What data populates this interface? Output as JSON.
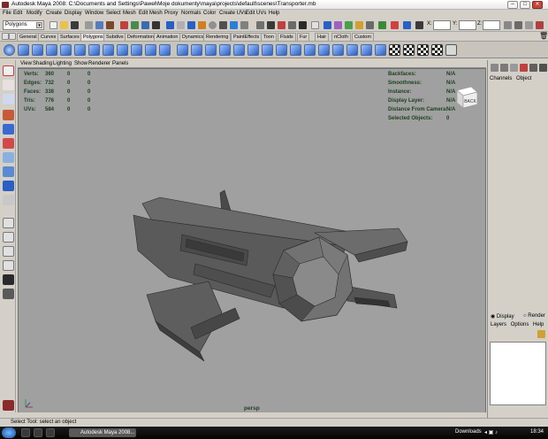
{
  "window": {
    "title": "Autodesk Maya 2008: C:\\Documents and Settings\\Paweł\\Moje dokumenty\\maya\\projects\\default\\scenes\\Transporter.mb"
  },
  "menubar": [
    "File",
    "Edit",
    "Modify",
    "Create",
    "Display",
    "Window",
    "Select",
    "Mesh",
    "Edit Mesh",
    "Proxy",
    "Normals",
    "Color",
    "Create UVs",
    "Edit UVs",
    "Help"
  ],
  "status_line": {
    "mode": "Polygons",
    "x_label": "X:",
    "y_label": "Y:",
    "z_label": "Z:"
  },
  "shelf_tabs": {
    "items": [
      "General",
      "Curves",
      "Surfaces",
      "Polygons",
      "Subdivs",
      "Deformation",
      "Animation",
      "Dynamics",
      "Rendering",
      "PaintEffects",
      "Toon",
      "Fluids",
      "Fur",
      "Hair",
      "nCloth",
      "Custom"
    ],
    "active": "Polygons"
  },
  "panel_menu": [
    "View",
    "Shading",
    "Lighting",
    "Show",
    "Renderer",
    "Panels"
  ],
  "hud_left": [
    {
      "label": "Verts:",
      "v1": "360",
      "v2": "0",
      "v3": "0"
    },
    {
      "label": "Edges:",
      "v1": "732",
      "v2": "0",
      "v3": "0"
    },
    {
      "label": "Faces:",
      "v1": "338",
      "v2": "0",
      "v3": "0"
    },
    {
      "label": "Tris:",
      "v1": "776",
      "v2": "0",
      "v3": "0"
    },
    {
      "label": "UVs:",
      "v1": "584",
      "v2": "0",
      "v3": "0"
    }
  ],
  "hud_right": [
    {
      "label": "Backfaces:",
      "value": "N/A"
    },
    {
      "label": "Smoothness:",
      "value": "N/A"
    },
    {
      "label": "Instance:",
      "value": "N/A"
    },
    {
      "label": "Display Layer:",
      "value": "N/A"
    },
    {
      "label": "Distance From Camera:",
      "value": "N/A"
    },
    {
      "label": "Selected Objects:",
      "value": "0"
    }
  ],
  "view_cube": {
    "label": "BACK"
  },
  "camera_label": "persp",
  "channel_box": {
    "tabs": [
      "Channels",
      "Object"
    ]
  },
  "layer_editor": {
    "display_label": "Display",
    "render_label": "Render",
    "menu": [
      "Layers",
      "Options",
      "Help"
    ]
  },
  "help_line": "Select Tool: select an object",
  "taskbar": {
    "active_app": "Autodesk Maya 2008...",
    "downloads": "Downloads",
    "clock": "18:34"
  },
  "colors": {
    "viewport_bg": "#a0a0a0",
    "hud_text": "#1c3f1c",
    "model_gray": "#5e5e5e",
    "shelf_icon": "#2a5fc4"
  }
}
